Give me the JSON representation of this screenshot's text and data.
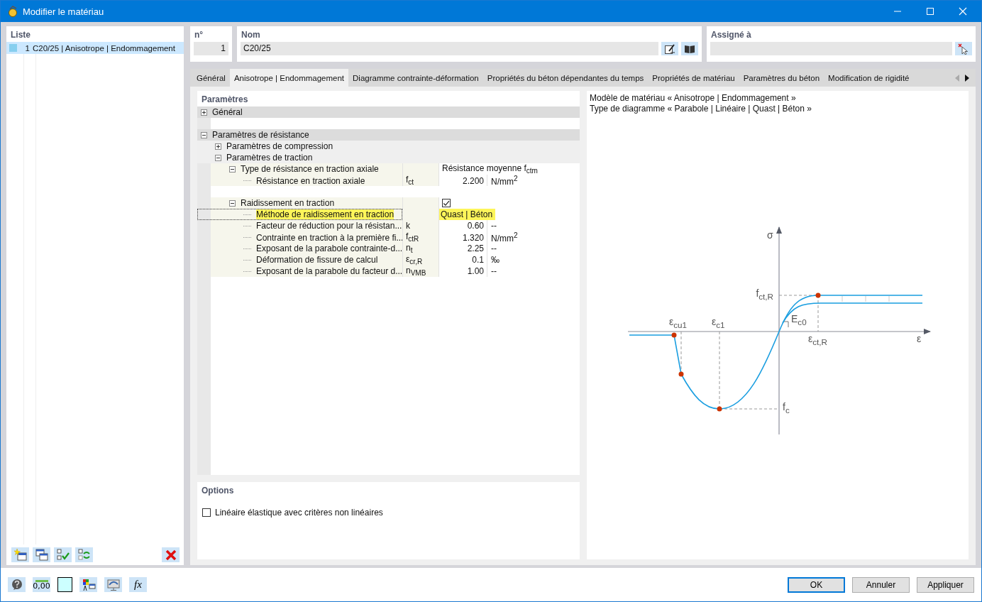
{
  "window": {
    "title": "Modifier le matériau"
  },
  "list": {
    "title": "Liste",
    "items": [
      {
        "number": "1",
        "name": "C20/25 | Anisotrope | Endommagement",
        "color": "#87cfef",
        "selected": true
      }
    ]
  },
  "number": {
    "label": "n°",
    "value": "1"
  },
  "name": {
    "label": "Nom",
    "value": "C20/25"
  },
  "assigned": {
    "label": "Assigné à"
  },
  "tabs": [
    {
      "label": "Général",
      "selected": false
    },
    {
      "label": "Anisotrope | Endommagement",
      "selected": true
    },
    {
      "label": "Diagramme contrainte-déformation",
      "selected": false
    },
    {
      "label": "Propriétés du béton dépendantes du temps",
      "selected": false
    },
    {
      "label": "Propriétés de matériau",
      "selected": false
    },
    {
      "label": "Paramètres du béton",
      "selected": false
    },
    {
      "label": "Modification de rigidité",
      "selected": false
    }
  ],
  "parameters": {
    "title": "Paramètres",
    "rows": [
      {
        "kind": "group",
        "label": "Général",
        "expanded": false,
        "selected": false
      },
      {
        "kind": "blank"
      },
      {
        "kind": "group",
        "label": "Paramètres de résistance",
        "expanded": true,
        "selected": false,
        "children": [
          {
            "kind": "group",
            "label": "Paramètres de compression",
            "expanded": false,
            "selected": false
          },
          {
            "kind": "group",
            "label": "Paramètres de traction",
            "expanded": true,
            "selected": false,
            "children": [
              {
                "kind": "property",
                "label": "Type de résistance en traction axiale",
                "value": "Résistance moyenne f$_{ctm}$",
                "expanded": true,
                "selected": false,
                "children": [
                  {
                    "kind": "property",
                    "label": "Résistance en traction axiale",
                    "symbol": "f$_{ct}$",
                    "value": "2.200",
                    "unit": "N/mm$^{2}$",
                    "selected": false
                  }
                ]
              },
              {
                "kind": "blank"
              },
              {
                "kind": "property",
                "label": "Raidissement en traction",
                "checked": true,
                "expanded": true,
                "selected": false,
                "children": [
                  {
                    "kind": "property",
                    "label": "Méthode de raidissement en traction",
                    "value": "Quast | Béton",
                    "selected": true
                  },
                  {
                    "kind": "property",
                    "label": "Facteur de réduction pour la résistan...",
                    "symbol": "k",
                    "value": "0.60",
                    "unit": "--",
                    "selected": false
                  },
                  {
                    "kind": "property",
                    "label": "Contrainte en traction à la première fi...",
                    "symbol": "f$_{ctR}$",
                    "value": "1.320",
                    "unit": "N/mm$^{2}$",
                    "selected": false
                  },
                  {
                    "kind": "property",
                    "label": "Exposant de la parabole contrainte-d...",
                    "symbol": "n$_{t}$",
                    "value": "2.25",
                    "unit": "--",
                    "selected": false
                  },
                  {
                    "kind": "property",
                    "label": "Déformation de fissure de calcul",
                    "symbol": "ε$_{cr,R}$",
                    "value": "0.1",
                    "unit": "‰",
                    "selected": false
                  },
                  {
                    "kind": "property",
                    "label": "Exposant de la parabole du facteur d...",
                    "symbol": "n$_{VMB}$",
                    "value": "1.00",
                    "unit": "--",
                    "selected": false
                  }
                ]
              }
            ]
          }
        ]
      }
    ]
  },
  "options": {
    "title": "Options",
    "items": [
      {
        "label": "Linéaire élastique avec critères non linéaires",
        "checked": false
      }
    ]
  },
  "diagram": {
    "lines": [
      "Modèle de matériau « Anisotrope | Endommagement »",
      "Type de diagramme « Parabole | Linéaire | Quast | Béton »"
    ],
    "labels": [
      "σ",
      "f$_{ct,R}$",
      "ε$_{cu1}$",
      "ε$_{c1}$",
      "E$_{c0}$",
      "ε$_{ct,R}$",
      "ε",
      "f$_{c}$"
    ]
  },
  "bottom_toolbar": [
    {
      "kind": "help"
    },
    {
      "kind": "decimals",
      "label": "0,00"
    },
    {
      "kind": "swatch"
    },
    {
      "kind": "legend"
    },
    {
      "kind": "display"
    },
    {
      "kind": "formula",
      "label": "fx"
    }
  ],
  "buttons": [
    {
      "label": "OK",
      "default": true
    },
    {
      "label": "Annuler",
      "default": false
    },
    {
      "label": "Appliquer",
      "default": false
    }
  ]
}
